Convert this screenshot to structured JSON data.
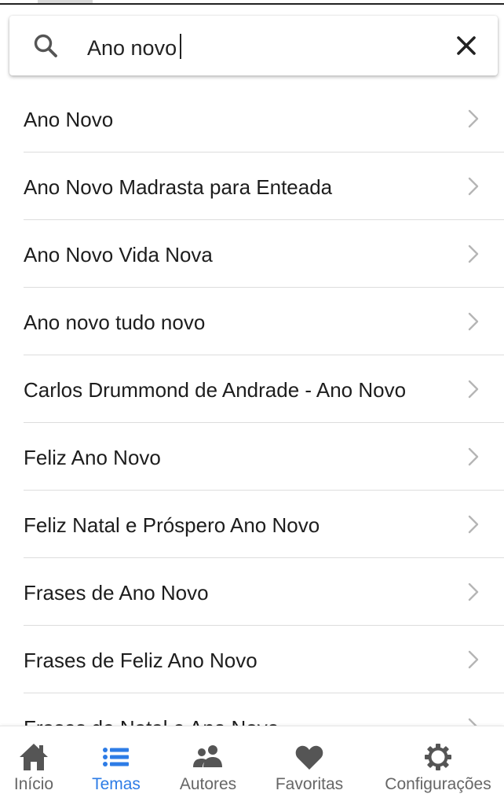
{
  "search": {
    "value": "Ano novo",
    "placeholder": ""
  },
  "results": [
    {
      "label": "Ano Novo"
    },
    {
      "label": "Ano Novo Madrasta para Enteada"
    },
    {
      "label": "Ano Novo Vida Nova"
    },
    {
      "label": "Ano novo tudo novo"
    },
    {
      "label": "Carlos Drummond de Andrade - Ano Novo"
    },
    {
      "label": "Feliz Ano Novo"
    },
    {
      "label": "Feliz Natal e Próspero Ano Novo"
    },
    {
      "label": "Frases de Ano Novo"
    },
    {
      "label": "Frases de Feliz Ano Novo"
    },
    {
      "label": "Frases de Natal e Ano Novo"
    }
  ],
  "nav": {
    "items": [
      {
        "label": "Início",
        "icon": "home-icon"
      },
      {
        "label": "Temas",
        "icon": "list-icon"
      },
      {
        "label": "Autores",
        "icon": "people-icon"
      },
      {
        "label": "Favoritas",
        "icon": "heart-icon"
      },
      {
        "label": "Configurações",
        "icon": "gear-icon"
      }
    ],
    "active": "Temas"
  },
  "colors": {
    "accent": "#2d7ce6",
    "nav_inactive": "#666666",
    "icon_gray": "#555555",
    "divider": "#dddddd"
  }
}
